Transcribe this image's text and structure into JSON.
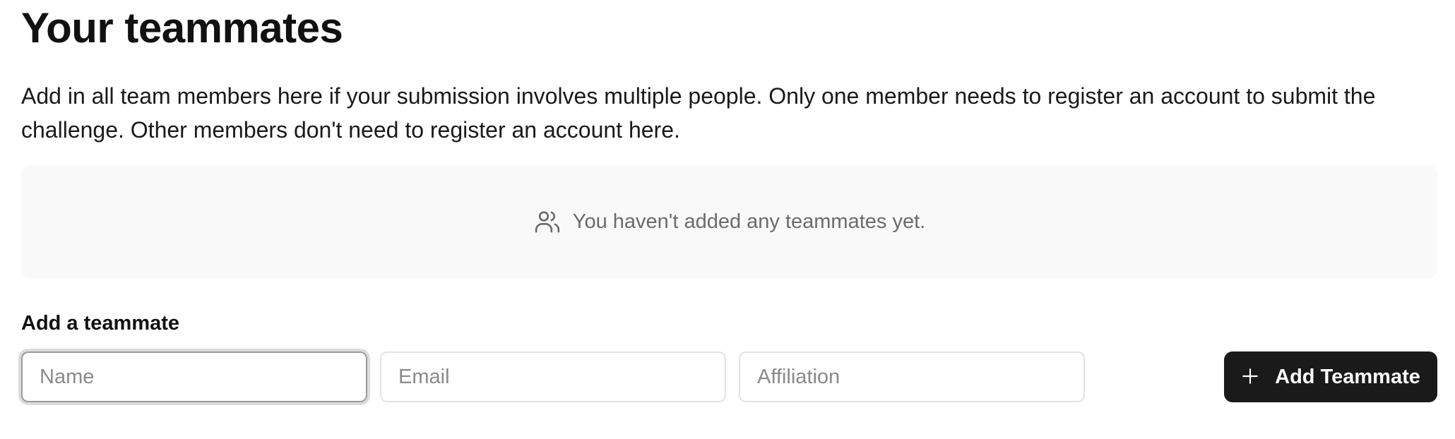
{
  "page": {
    "title": "Your teammates",
    "description": "Add in all team members here if your submission involves multiple people. Only one member needs to register an account to submit the challenge. Other members don't need to register an account here."
  },
  "empty_state": {
    "icon": "users-icon",
    "text": "You haven't added any teammates yet."
  },
  "add_form": {
    "label": "Add a teammate",
    "name_field": {
      "placeholder": "Name",
      "value": ""
    },
    "email_field": {
      "placeholder": "Email",
      "value": ""
    },
    "affiliation_field": {
      "placeholder": "Affiliation",
      "value": ""
    },
    "button": {
      "icon": "plus-icon",
      "label": "Add Teammate"
    }
  },
  "colors": {
    "button_bg": "#1a1a1a",
    "empty_bg": "#f9f9f9",
    "muted_text": "#6b6b6b"
  }
}
